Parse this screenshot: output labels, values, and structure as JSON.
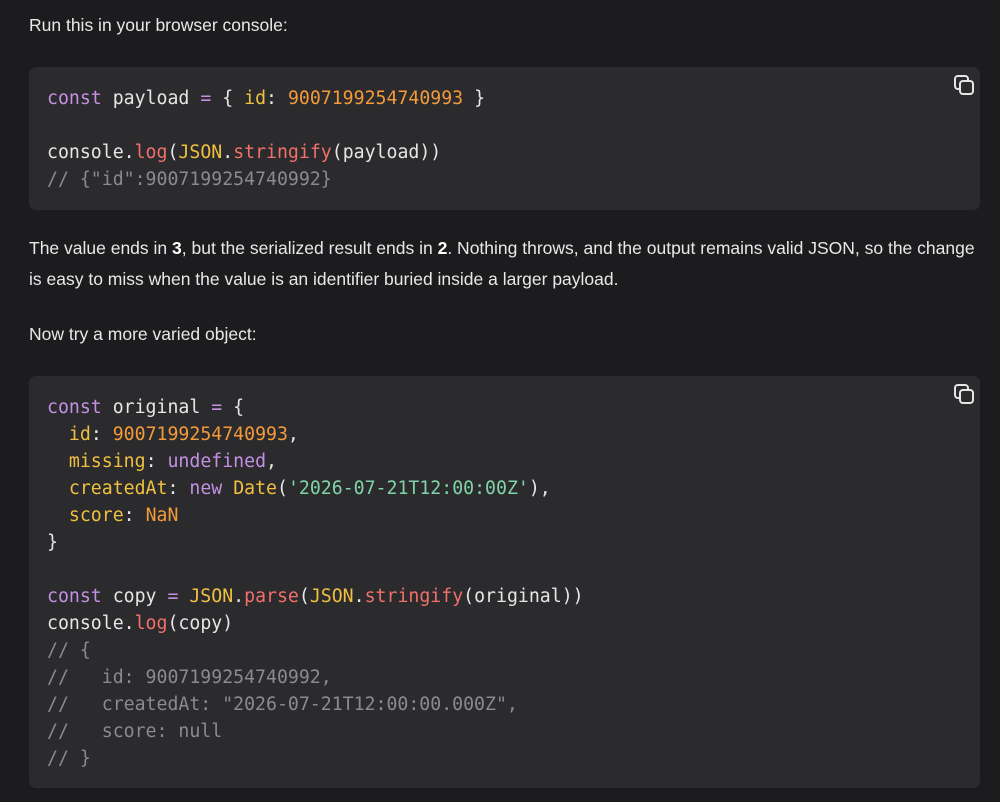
{
  "intro": "Run this in your browser console:",
  "explanation": {
    "part1": "The value ends in ",
    "bold1": "3",
    "part2": ", but the serialized result ends in ",
    "bold2": "2",
    "part3": ". Nothing throws, and the output remains valid JSON, so the change is easy to miss when the value is an identifier buried inside a larger payload."
  },
  "try_more": "Now try a more varied object:",
  "copy_button": {
    "icon": "copy-icon"
  },
  "code1": [
    [
      [
        "kw",
        "const"
      ],
      [
        "pl",
        " payload "
      ],
      [
        "op",
        "="
      ],
      [
        "pl",
        " { "
      ],
      [
        "prop",
        "id"
      ],
      [
        "pl",
        ": "
      ],
      [
        "num",
        "9007199254740993"
      ],
      [
        "pl",
        " }"
      ]
    ],
    [],
    [
      [
        "pl",
        "console."
      ],
      [
        "fn",
        "log"
      ],
      [
        "pl",
        "("
      ],
      [
        "glb",
        "JSON"
      ],
      [
        "pl",
        "."
      ],
      [
        "fn",
        "stringify"
      ],
      [
        "pl",
        "(payload))"
      ]
    ],
    [
      [
        "cm",
        "// {\"id\":9007199254740992}"
      ]
    ]
  ],
  "code2": [
    [
      [
        "kw",
        "const"
      ],
      [
        "pl",
        " original "
      ],
      [
        "op",
        "="
      ],
      [
        "pl",
        " {"
      ]
    ],
    [
      [
        "pl",
        "  "
      ],
      [
        "prop",
        "id"
      ],
      [
        "pl",
        ": "
      ],
      [
        "num",
        "9007199254740993"
      ],
      [
        "pl",
        ","
      ]
    ],
    [
      [
        "pl",
        "  "
      ],
      [
        "prop",
        "missing"
      ],
      [
        "pl",
        ": "
      ],
      [
        "kw",
        "undefined"
      ],
      [
        "pl",
        ","
      ]
    ],
    [
      [
        "pl",
        "  "
      ],
      [
        "prop",
        "createdAt"
      ],
      [
        "pl",
        ": "
      ],
      [
        "kw",
        "new"
      ],
      [
        "pl",
        " "
      ],
      [
        "glb",
        "Date"
      ],
      [
        "pl",
        "("
      ],
      [
        "str",
        "'2026-07-21T12:00:00Z'"
      ],
      [
        "pl",
        "),"
      ]
    ],
    [
      [
        "pl",
        "  "
      ],
      [
        "prop",
        "score"
      ],
      [
        "pl",
        ": "
      ],
      [
        "num",
        "NaN"
      ]
    ],
    [
      [
        "pl",
        "}"
      ]
    ],
    [],
    [
      [
        "kw",
        "const"
      ],
      [
        "pl",
        " copy "
      ],
      [
        "op",
        "="
      ],
      [
        "pl",
        " "
      ],
      [
        "glb",
        "JSON"
      ],
      [
        "pl",
        "."
      ],
      [
        "fn",
        "parse"
      ],
      [
        "pl",
        "("
      ],
      [
        "glb",
        "JSON"
      ],
      [
        "pl",
        "."
      ],
      [
        "fn",
        "stringify"
      ],
      [
        "pl",
        "(original))"
      ]
    ],
    [
      [
        "pl",
        "console."
      ],
      [
        "fn",
        "log"
      ],
      [
        "pl",
        "(copy)"
      ]
    ],
    [
      [
        "cm",
        "// {"
      ]
    ],
    [
      [
        "cm",
        "//   id: 9007199254740992,"
      ]
    ],
    [
      [
        "cm",
        "//   createdAt: \"2026-07-21T12:00:00.000Z\","
      ]
    ],
    [
      [
        "cm",
        "//   score: null"
      ]
    ],
    [
      [
        "cm",
        "// }"
      ]
    ]
  ]
}
